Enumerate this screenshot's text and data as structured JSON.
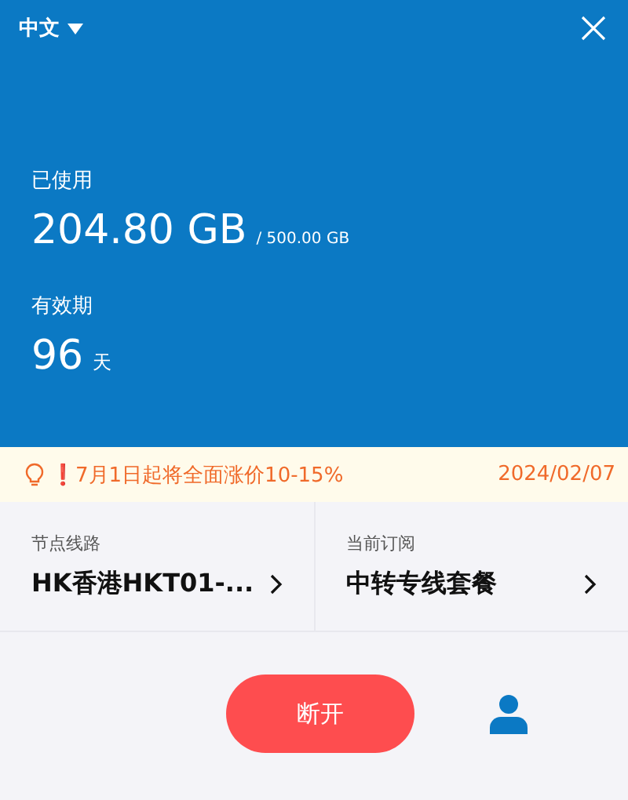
{
  "header": {
    "language": "中文",
    "usage_label": "已使用",
    "used": "204.80 GB",
    "total": "/ 500.00 GB",
    "validity_label": "有效期",
    "days": "96",
    "days_unit": "天"
  },
  "notice": {
    "text": "❗7月1日起将全面涨价10-15%",
    "date": "2024/02/07"
  },
  "cards": [
    {
      "label": "节点线路",
      "value": "HK香港HKT01-..."
    },
    {
      "label": "当前订阅",
      "value": "中转专线套餐"
    }
  ],
  "connect_button": "断开"
}
